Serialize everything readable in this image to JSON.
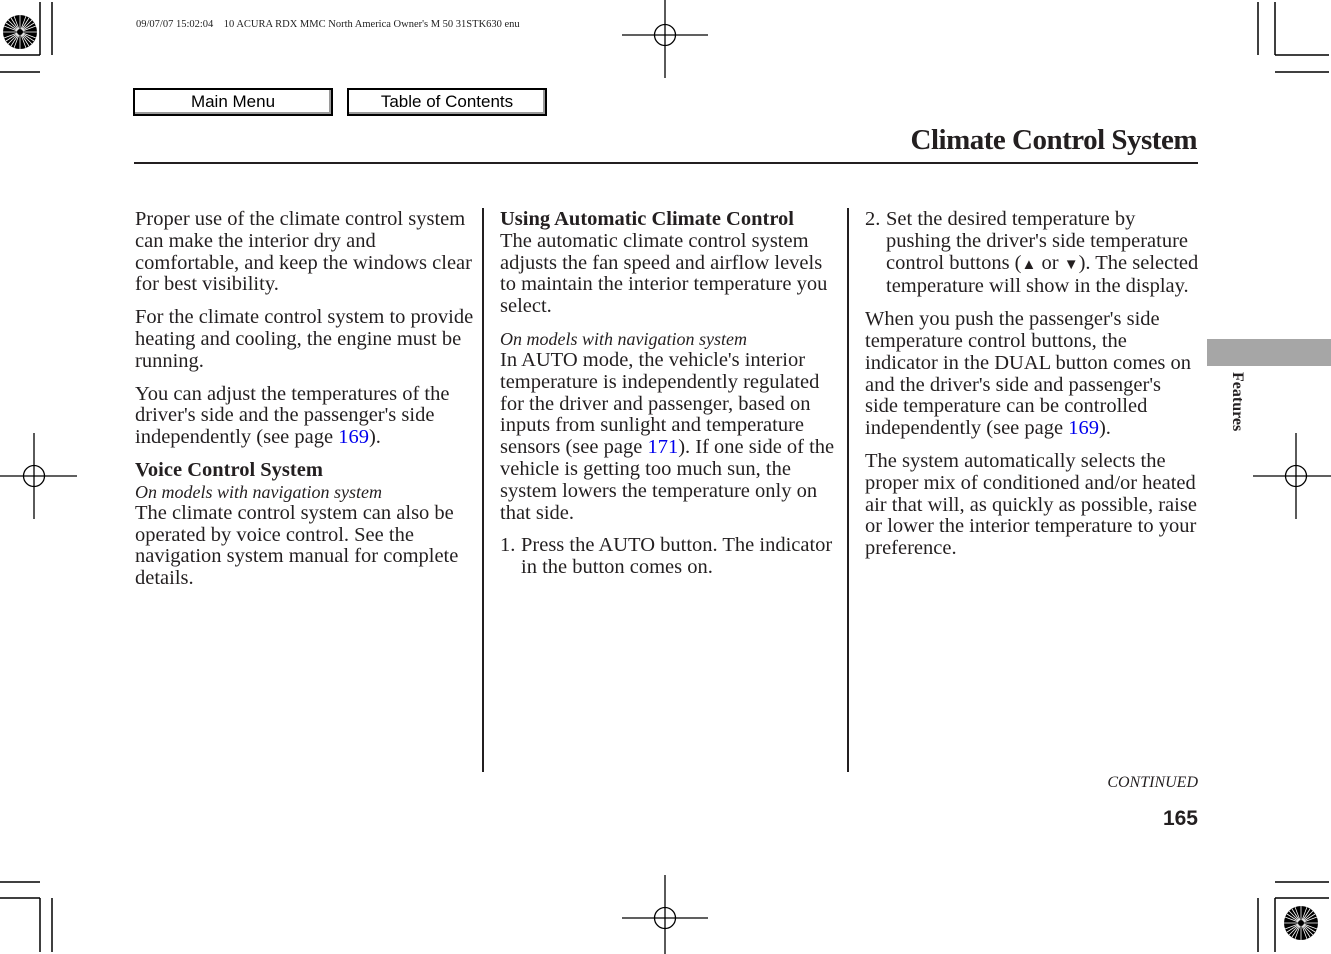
{
  "print_header": "09/07/07 15:02:04    10 ACURA RDX MMC North America Owner's M 50 31STK630 enu",
  "nav": {
    "main_menu": "Main Menu",
    "table_of_contents": "Table of Contents"
  },
  "page": {
    "title": "Climate Control System",
    "section_tab": "Features",
    "continued": "CONTINUED",
    "number": "165"
  },
  "col1": {
    "p1": "Proper use of the climate control system can make the interior dry and comfortable, and keep the windows clear for best visibility.",
    "p2": "For the climate control system to provide heating and cooling, the engine must be running.",
    "p3_before": "You can adjust the temperatures of the driver's side and the passenger's side independently (see page ",
    "p3_link": "169",
    "p3_after": ").",
    "voice_heading": "Voice Control System",
    "voice_condition": "On models with navigation system",
    "voice_text": "The climate control system can also be operated by voice control. See the navigation system manual for complete details."
  },
  "col2": {
    "heading": "Using Automatic Climate Control",
    "intro": "The automatic climate control system adjusts the fan speed and airflow levels to maintain the interior temperature you select.",
    "condition": "On models with navigation system",
    "auto_before": "In AUTO mode, the vehicle's interior temperature is independently regulated for the driver and passenger, based on inputs from sunlight and temperature sensors (see page ",
    "auto_link": "171",
    "auto_after": "). If one side of the vehicle is getting too much sun, the system lowers the temperature only on that side.",
    "step1_num": "1.",
    "step1_text": "Press the AUTO button. The indicator in the button comes on."
  },
  "col3": {
    "step2_num": "2.",
    "step2_before": "Set the desired temperature by pushing the driver's side temperature control buttons (",
    "up_glyph": "▲",
    "step2_mid": " or ",
    "down_glyph": "▼",
    "step2_after": "). The selected temperature will show in the display.",
    "dual_before": "When you push the passenger's side temperature control buttons, the indicator in the DUAL button comes on and the driver's side and passenger's side temperature can be controlled independently (see page ",
    "dual_link": "169",
    "dual_after": ").",
    "mix": "The system automatically selects the proper mix of conditioned and/or heated air that will, as quickly as possible, raise or lower the interior temperature to your preference."
  }
}
